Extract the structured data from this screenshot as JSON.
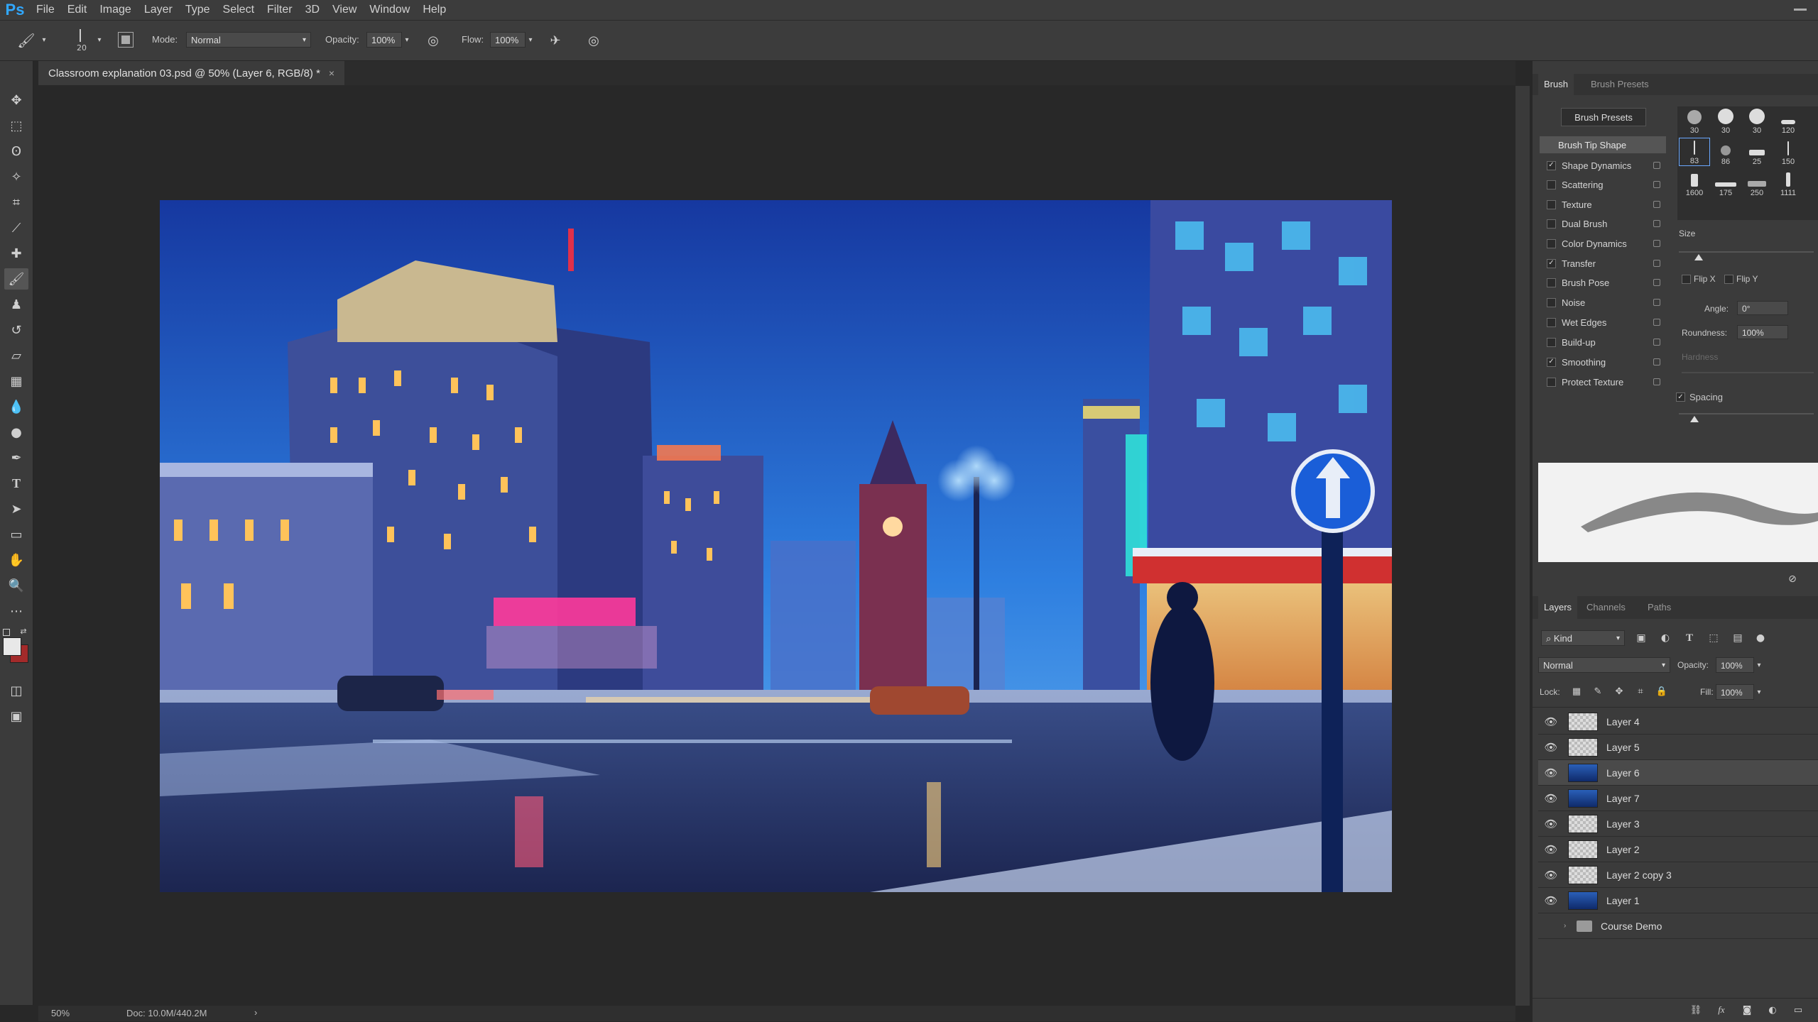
{
  "app": {
    "logo": "Ps",
    "menu": [
      "File",
      "Edit",
      "Image",
      "Layer",
      "Type",
      "Select",
      "Filter",
      "3D",
      "View",
      "Window",
      "Help"
    ]
  },
  "options_bar": {
    "brush_size": "20",
    "mode_label": "Mode:",
    "mode_value": "Normal",
    "opacity_label": "Opacity:",
    "opacity_value": "100%",
    "flow_label": "Flow:",
    "flow_value": "100%"
  },
  "document": {
    "tab_title": "Classroom explanation 03.psd @ 50% (Layer 6, RGB/8) *",
    "close_glyph": "×"
  },
  "status": {
    "zoom": "50%",
    "doc_size": "Doc: 10.0M/440.2M",
    "arrow": "›"
  },
  "brush_panel": {
    "tabs": [
      "Brush",
      "Brush Presets"
    ],
    "presets_button": "Brush Presets",
    "tip_shape": "Brush Tip Shape",
    "options": [
      {
        "label": "Shape Dynamics",
        "checked": true
      },
      {
        "label": "Scattering",
        "checked": false
      },
      {
        "label": "Texture",
        "checked": false
      },
      {
        "label": "Dual Brush",
        "checked": false
      },
      {
        "label": "Color Dynamics",
        "checked": false
      },
      {
        "label": "Transfer",
        "checked": true
      },
      {
        "label": "Brush Pose",
        "checked": false
      },
      {
        "label": "Noise",
        "checked": false
      },
      {
        "label": "Wet Edges",
        "checked": false
      },
      {
        "label": "Build-up",
        "checked": false
      },
      {
        "label": "Smoothing",
        "checked": true
      },
      {
        "label": "Protect Texture",
        "checked": false
      }
    ],
    "tip_sizes": [
      "30",
      "30",
      "30",
      "120",
      "83",
      "86",
      "25",
      "150",
      "1600",
      "175",
      "250",
      "1111"
    ],
    "size_label": "Size",
    "flip_x": "Flip X",
    "flip_y": "Flip Y",
    "angle_label": "Angle:",
    "angle_value": "0°",
    "roundness_label": "Roundness:",
    "roundness_value": "100%",
    "hardness_label": "Hardness",
    "spacing_label": "Spacing"
  },
  "layers_panel": {
    "tabs": [
      "Layers",
      "Channels",
      "Paths"
    ],
    "kind_label": "Kind",
    "blend_mode": "Normal",
    "opacity_label": "Opacity:",
    "opacity_value": "100%",
    "lock_label": "Lock:",
    "fill_label": "Fill:",
    "fill_value": "100%",
    "layers": [
      {
        "name": "Layer 4",
        "selected": false
      },
      {
        "name": "Layer 5",
        "selected": false
      },
      {
        "name": "Layer 6",
        "selected": true
      },
      {
        "name": "Layer 7",
        "selected": false
      },
      {
        "name": "Layer 3",
        "selected": false
      },
      {
        "name": "Layer 2",
        "selected": false
      },
      {
        "name": "Layer 2 copy 3",
        "selected": false
      },
      {
        "name": "Layer 1",
        "selected": false
      }
    ],
    "group_name": "Course Demo",
    "bottom_icons": [
      "link-icon",
      "fx-icon",
      "mask-icon",
      "adjustment-icon",
      "folder-icon"
    ]
  },
  "colors": {
    "accent": "#31a8ff",
    "panel_bg": "#3b3b3b",
    "canvas_bg": "#282828",
    "sky_top": "#1a3fa8",
    "sky_bottom": "#2d78d8"
  }
}
